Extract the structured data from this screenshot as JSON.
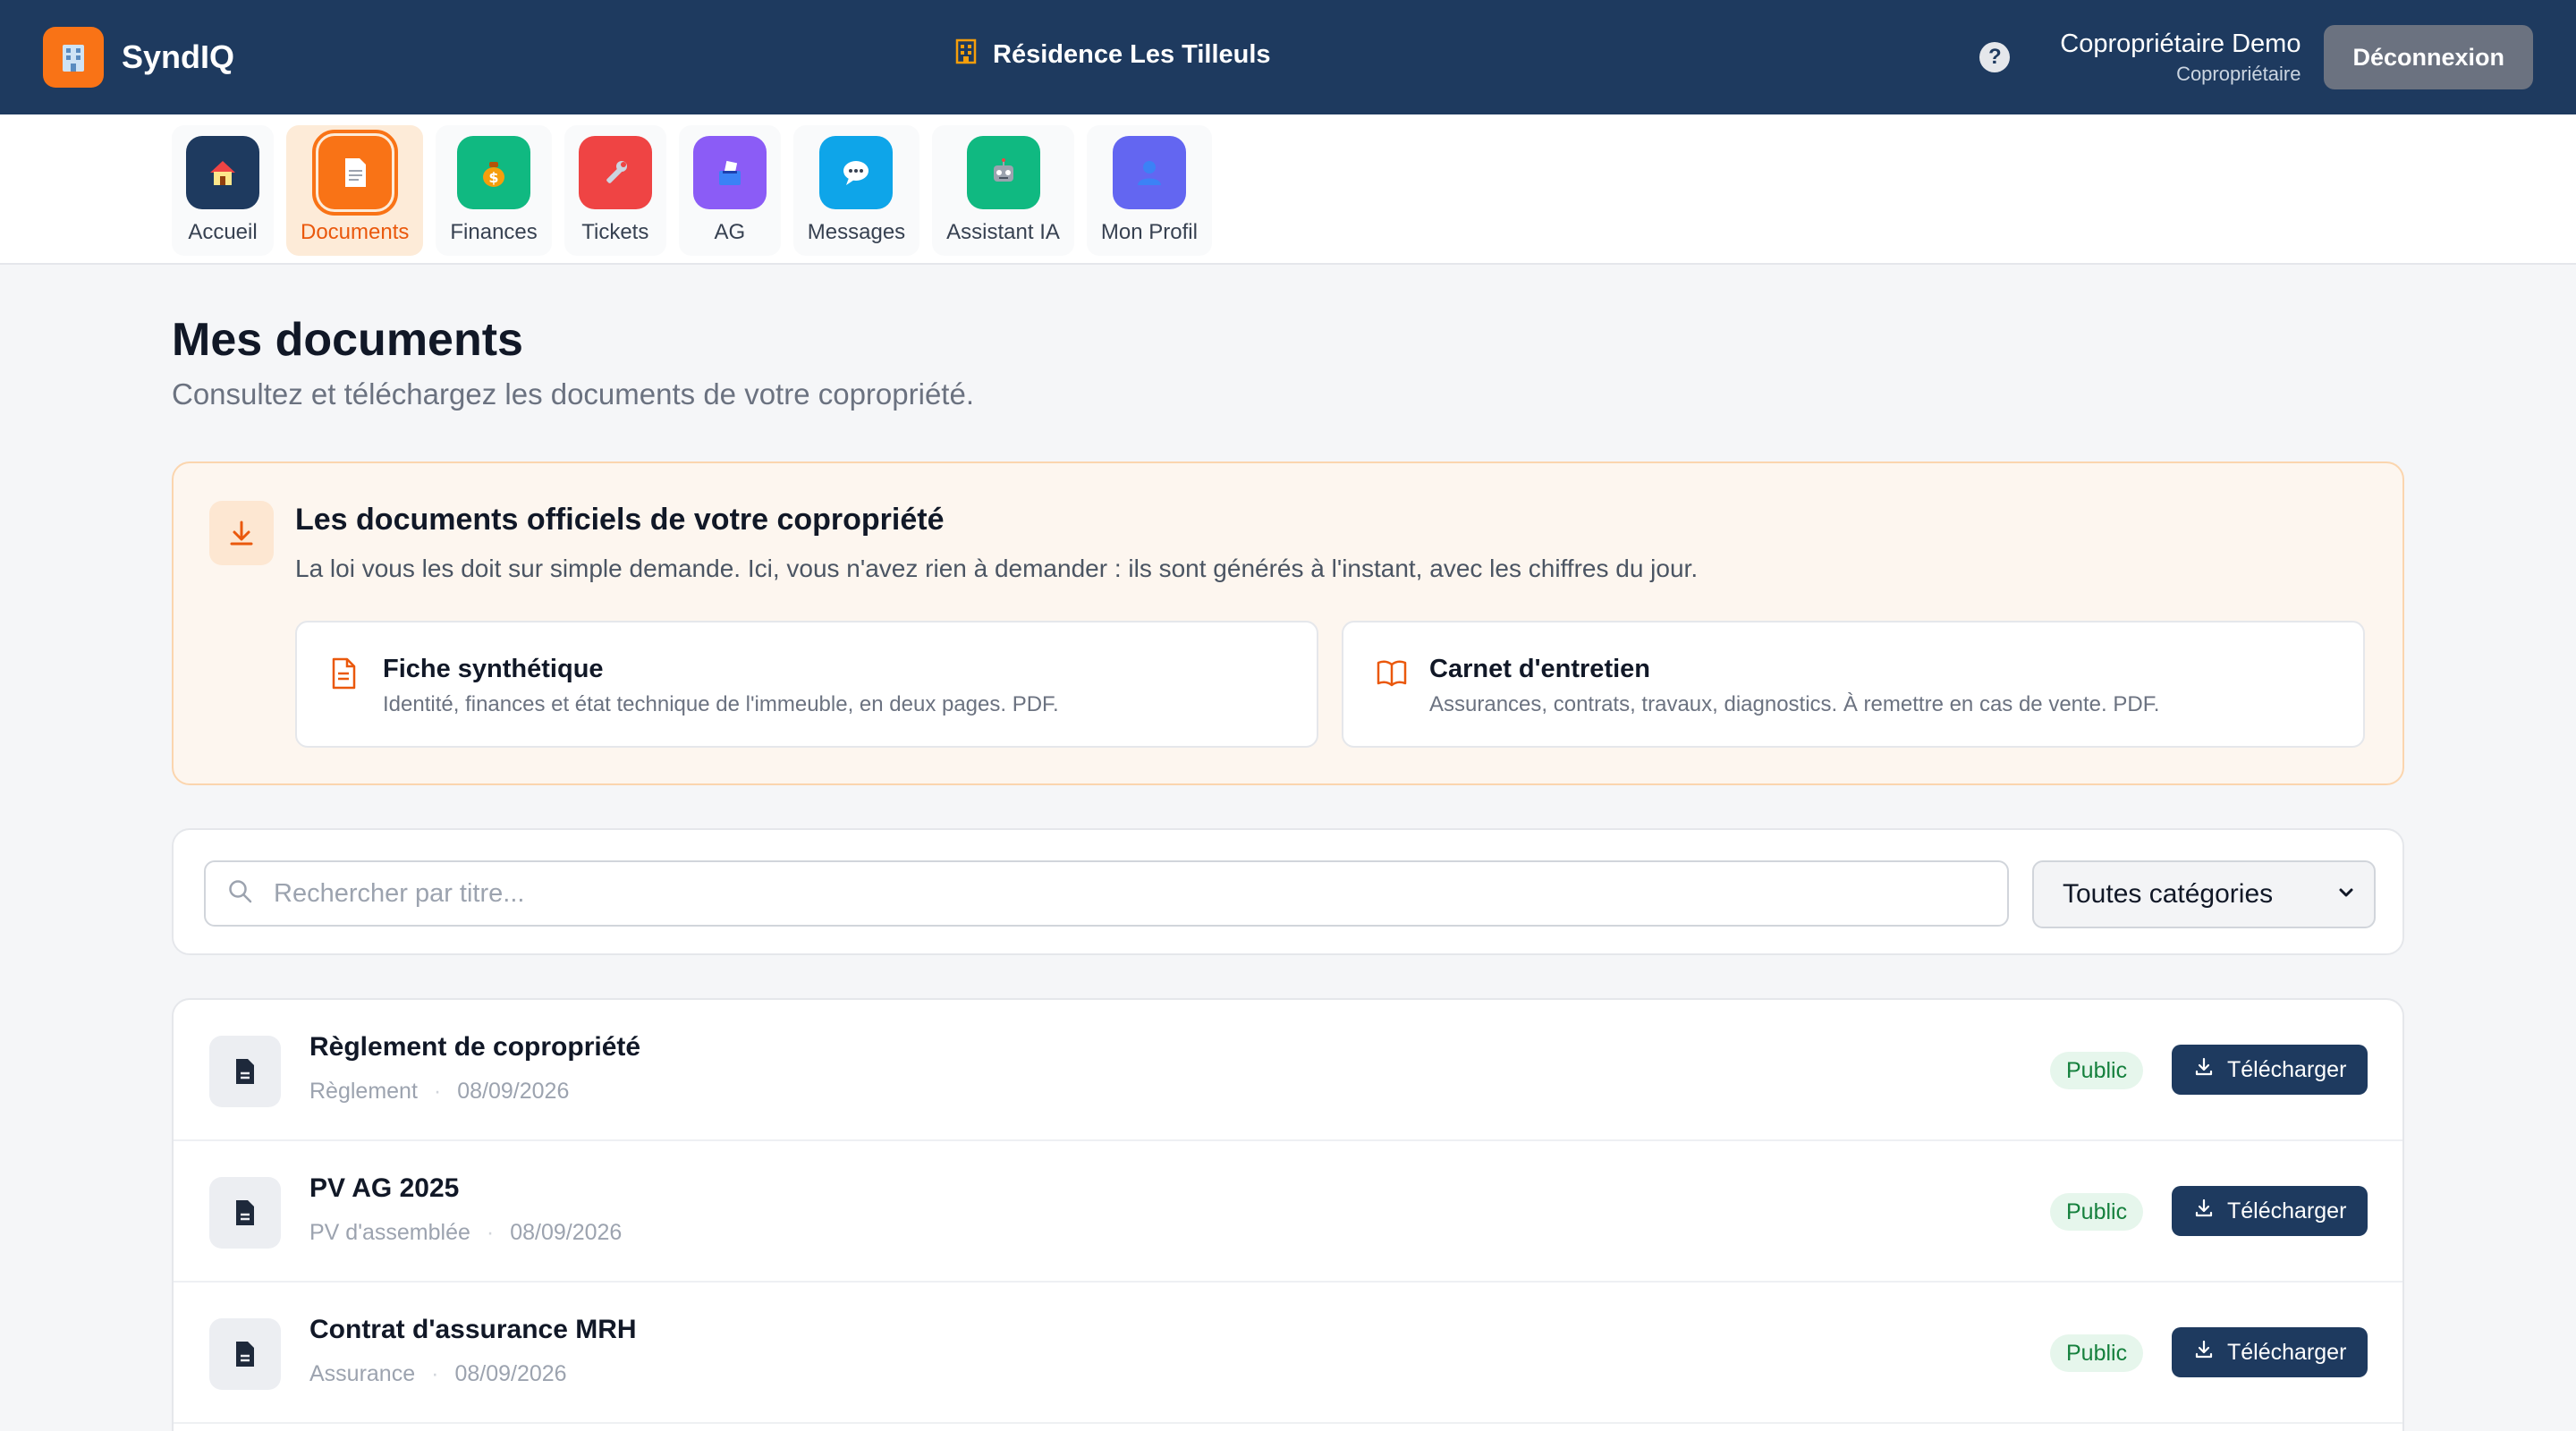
{
  "header": {
    "brand": "SyndIQ",
    "residence": "Résidence Les Tilleuls",
    "user_name": "Copropriétaire Demo",
    "user_role": "Copropriétaire",
    "logout_label": "Déconnexion"
  },
  "nav": {
    "items": [
      {
        "label": "Accueil",
        "icon": "house-icon",
        "color": "#1e3a5f"
      },
      {
        "label": "Documents",
        "icon": "document-icon",
        "color": "#f97316",
        "active": true
      },
      {
        "label": "Finances",
        "icon": "money-bag-icon",
        "color": "#10b981"
      },
      {
        "label": "Tickets",
        "icon": "wrench-icon",
        "color": "#ef4444"
      },
      {
        "label": "AG",
        "icon": "ballot-box-icon",
        "color": "#8b5cf6"
      },
      {
        "label": "Messages",
        "icon": "speech-bubble-icon",
        "color": "#0ea5e9"
      },
      {
        "label": "Assistant IA",
        "icon": "robot-icon",
        "color": "#10b981"
      },
      {
        "label": "Mon Profil",
        "icon": "person-icon",
        "color": "#6366f1"
      }
    ]
  },
  "page": {
    "title": "Mes documents",
    "subtitle": "Consultez et téléchargez les documents de votre copropriété."
  },
  "official": {
    "title": "Les documents officiels de votre copropriété",
    "description": "La loi vous les doit sur simple demande. Ici, vous n'avez rien à demander : ils sont générés à l'instant, avec les chiffres du jour.",
    "cards": [
      {
        "title": "Fiche synthétique",
        "description": "Identité, finances et état technique de l'immeuble, en deux pages. PDF."
      },
      {
        "title": "Carnet d'entretien",
        "description": "Assurances, contrats, travaux, diagnostics. À remettre en cas de vente. PDF."
      }
    ]
  },
  "search": {
    "placeholder": "Rechercher par titre...",
    "category_selected": "Toutes catégories"
  },
  "documents": [
    {
      "title": "Règlement de copropriété",
      "category": "Règlement",
      "date": "08/09/2026",
      "visibility": "Public",
      "action": "Télécharger"
    },
    {
      "title": "PV AG 2025",
      "category": "PV d'assemblée",
      "date": "08/09/2026",
      "visibility": "Public",
      "action": "Télécharger"
    },
    {
      "title": "Contrat d'assurance MRH",
      "category": "Assurance",
      "date": "08/09/2026",
      "visibility": "Public",
      "action": "Télécharger"
    }
  ],
  "colors": {
    "header_bg": "#1e3a5f",
    "accent": "#f97316",
    "public_badge": "#15803d"
  }
}
